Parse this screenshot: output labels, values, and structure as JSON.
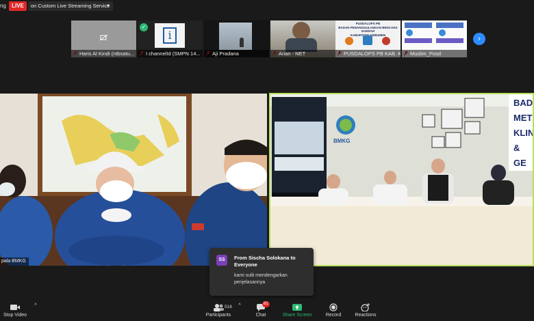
{
  "topbar": {
    "recording_tail": "ng",
    "live_label": "LIVE",
    "stream_label": "on Custom Live Streaming Service"
  },
  "thumbnails": [
    {
      "name": "Haris Al Kindi (ntbsatu..."
    },
    {
      "name": "I channelId (SMPN 14..."
    },
    {
      "name": "Aji Pradana"
    },
    {
      "name": "Arian - NET"
    },
    {
      "name": "PUSDALOPS PB KAB. K..."
    },
    {
      "name": "Muslim_Posd"
    }
  ],
  "thumb_text": {
    "pusdalops_1": "PUSDALOPS PB",
    "pusdalops_2": "BADAN PENANGGULANGAN BENCANA DAERAH",
    "pusdalops_3": "KABUPATEN KEBUMEN"
  },
  "left_video": {
    "name_label": "pala BMKG"
  },
  "right_video": {
    "banner_text": [
      "BAD",
      "MET",
      "KLIN",
      "& GE"
    ],
    "logo_text": "BMKG"
  },
  "chat_popup": {
    "avatar_initials": "SS",
    "from": "From Sischa Solokana to Everyone",
    "message": "kami sulit mendengarkan penjelasannya"
  },
  "toolbar": {
    "stop_video": "Stop Video",
    "participants": "Participants",
    "participants_count": "516",
    "chat": "Chat",
    "chat_badge": "81",
    "share_screen": "Share Screen",
    "record": "Record",
    "reactions": "Reactions"
  },
  "colors": {
    "live": "#e02828",
    "active_speaker_border": "#b8e05a",
    "share_green": "#2eb872",
    "accent_blue": "#2d8cff"
  }
}
